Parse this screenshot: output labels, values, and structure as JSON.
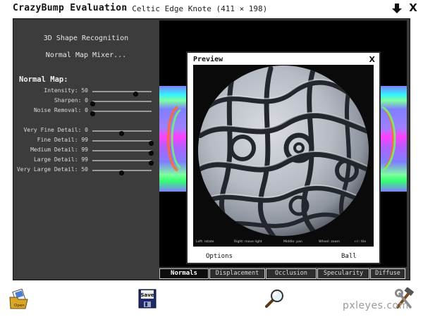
{
  "window": {
    "app_title": "CrazyBump Evaluation",
    "document_title": "- Celtic Edge Knote (411 × 198)",
    "close_glyph": "X"
  },
  "left_panel": {
    "links": {
      "shape_recognition": "3D Shape Recognition",
      "normal_map_mixer": "Normal Map Mixer..."
    },
    "normal_map_header": "Normal Map:",
    "sliders": [
      {
        "label": "Intensity: 50",
        "value": 0.73
      },
      {
        "label": "Sharpen: 0",
        "value": 0.0
      },
      {
        "label": "Noise Removal: 0",
        "value": 0.0
      },
      {
        "label": "Very Fine Detail: 0",
        "value": 0.49
      },
      {
        "label": "Fine Detail: 99",
        "value": 0.99
      },
      {
        "label": "Medium Detail: 99",
        "value": 0.99
      },
      {
        "label": "Large Detail: 99",
        "value": 0.99
      },
      {
        "label": "Very Large Detail: 50",
        "value": 0.49
      }
    ]
  },
  "tabs": [
    {
      "label": "Normals",
      "active": true
    },
    {
      "label": "Displacement",
      "active": false
    },
    {
      "label": "Occlusion",
      "active": false
    },
    {
      "label": "Specularity",
      "active": false
    },
    {
      "label": "Diffuse",
      "active": false
    }
  ],
  "preview": {
    "title": "Preview",
    "close_glyph": "X",
    "hints": [
      "Left: rotate",
      "Right: move light",
      "Middle: pan",
      "Wheel: zoom",
      "+/-: tile"
    ],
    "options_label": "Options",
    "shape_label": "Ball"
  },
  "toolbar": {
    "save_label": "Save",
    "open_label": "Open"
  },
  "watermark": "pxleyes.com",
  "colors": {
    "frame_dark": "#3a3a3a",
    "normal_map_blue": "#7f7fff",
    "sphere_base": "#b9bcc4"
  }
}
